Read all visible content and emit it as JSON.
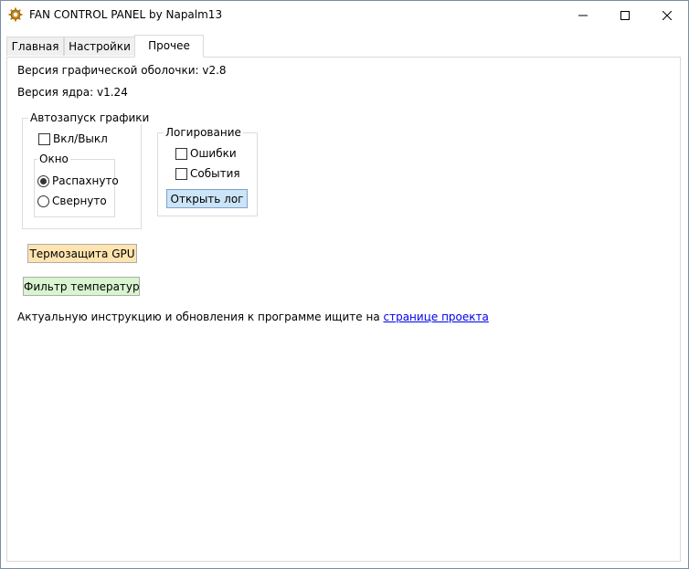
{
  "window": {
    "title": "FAN CONTROL PANEL by Napalm13",
    "icon": "gear-icon"
  },
  "tabs": [
    {
      "label": "Главная",
      "active": false
    },
    {
      "label": "Настройки",
      "active": false
    },
    {
      "label": "Прочее",
      "active": true
    }
  ],
  "info": {
    "gui_version": "Версия графической оболочки: v2.8",
    "core_version": "Версия ядра: v1.24"
  },
  "autostart": {
    "legend": "Автозапуск графики",
    "toggle_label": "Вкл/Выкл",
    "toggle_checked": false,
    "window_group": {
      "legend": "Окно",
      "options": [
        {
          "label": "Распахнуто",
          "checked": true
        },
        {
          "label": "Свернуто",
          "checked": false
        }
      ]
    }
  },
  "logging": {
    "legend": "Логирование",
    "options": [
      {
        "label": "Ошибки",
        "checked": false
      },
      {
        "label": "События",
        "checked": false
      }
    ],
    "open_log_button": "Открыть лог"
  },
  "buttons": {
    "gpu_protection": "Термозащита GPU",
    "temp_filter": "Фильтр температур"
  },
  "footer": {
    "text": "Актуальную инструкцию и обновления к программе ищите на",
    "link_text": "странице проекта"
  },
  "colors": {
    "gpu_button_bg": "#ffe4b0",
    "filter_button_bg": "#d9f5d0",
    "log_button_bg": "#cce4f7",
    "link": "#0000ee"
  }
}
